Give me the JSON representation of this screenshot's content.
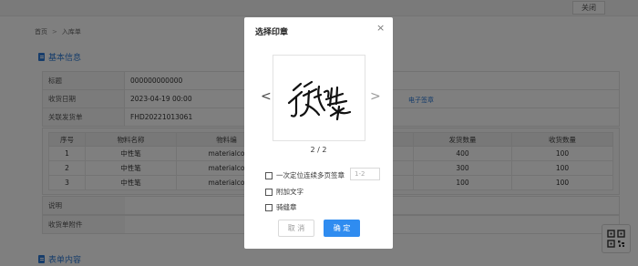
{
  "topbar": {
    "close_label": "关闭"
  },
  "breadcrumb": {
    "home": "首页",
    "separator": ">",
    "current": "入库单"
  },
  "section_basic": {
    "title": "基本信息"
  },
  "section_form": {
    "title": "表单内容"
  },
  "info": {
    "title_label": "标题",
    "title_value": "000000000000",
    "date_label": "收货日期",
    "date_value": "2023-04-19 00:00",
    "delivery_label": "关联发货单",
    "delivery_value": "FHD20221013061",
    "link_text": "电子签章"
  },
  "items": {
    "headers": [
      "序号",
      "物料名称",
      "物料编",
      "",
      "发货数量",
      "收货数量"
    ],
    "rows": [
      [
        "1",
        "中性笔",
        "materialco",
        "",
        "400",
        "100"
      ],
      [
        "2",
        "中性笔",
        "materialco",
        "",
        "300",
        "100"
      ],
      [
        "3",
        "中性笔",
        "materialco",
        "",
        "100",
        "100"
      ]
    ]
  },
  "extra": {
    "desc_label": "说明",
    "attach_label": "收货单附件"
  },
  "modal": {
    "title": "选择印章",
    "close_symbol": "×",
    "prev_symbol": "<",
    "next_symbol": ">",
    "page_indicator": "2 / 2",
    "option_multi": "一次定位连续多页签章",
    "range_placeholder": "1-2",
    "option_text": "附加文字",
    "option_seam": "骑缝章",
    "cancel_label": "取 消",
    "ok_label": "确 定"
  },
  "colors": {
    "accent": "#2f8cf0",
    "link": "#2e7bd6",
    "overlay": "rgba(0,0,0,0.5)"
  }
}
